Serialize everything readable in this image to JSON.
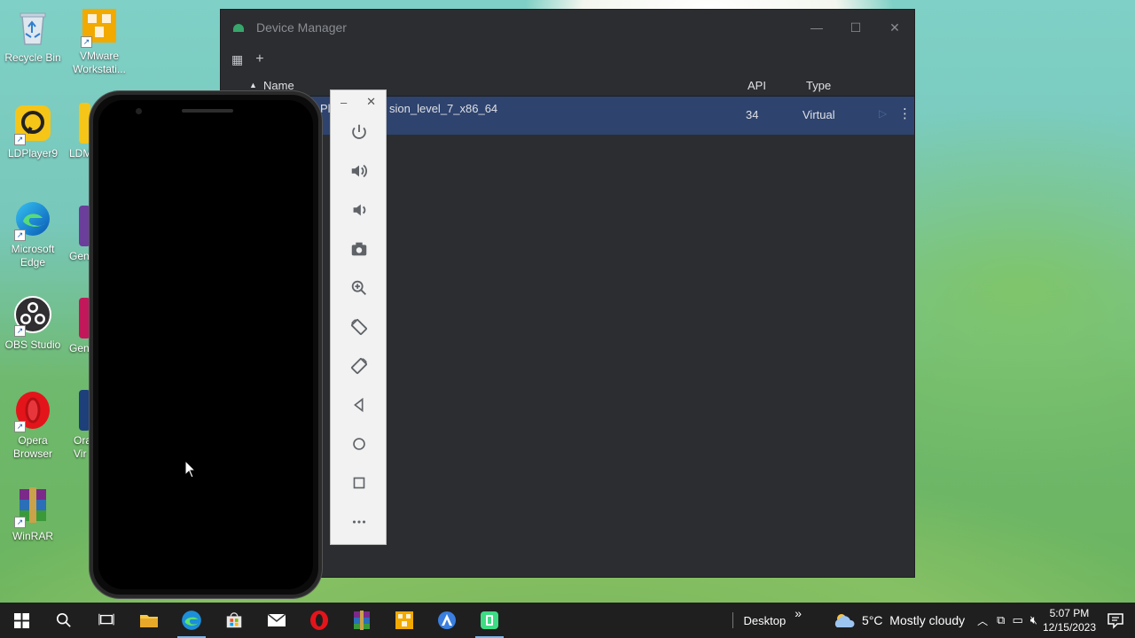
{
  "desktop": {
    "icons": [
      {
        "label": "Recycle Bin"
      },
      {
        "label": "VMware Workstati..."
      },
      {
        "label": "LDPlayer9"
      },
      {
        "label": "LDM"
      },
      {
        "label": "Microsoft Edge"
      },
      {
        "label": "Gen"
      },
      {
        "label": "OBS Studio"
      },
      {
        "label": "Gen"
      },
      {
        "label": "Opera Browser"
      },
      {
        "label": "Ora Vir"
      },
      {
        "label": "WinRAR"
      }
    ]
  },
  "device_manager": {
    "title": "Device Manager",
    "columns": {
      "name": "Name",
      "api": "API",
      "type": "Type"
    },
    "rows": [
      {
        "name_visible": "sion_level_7_x86_64",
        "name_fragment": "Pl",
        "api": "34",
        "type": "Virtual"
      }
    ]
  },
  "taskbar": {
    "desktop_label": "Desktop",
    "chevron": "»",
    "weather": "5°C  Mostly cloudy",
    "time": "5:07 PM",
    "date": "12/15/2023"
  },
  "colors": {
    "window_bg": "#2b2d30",
    "selected_row": "#2e436e",
    "taskbar": "#1f1f1f"
  }
}
